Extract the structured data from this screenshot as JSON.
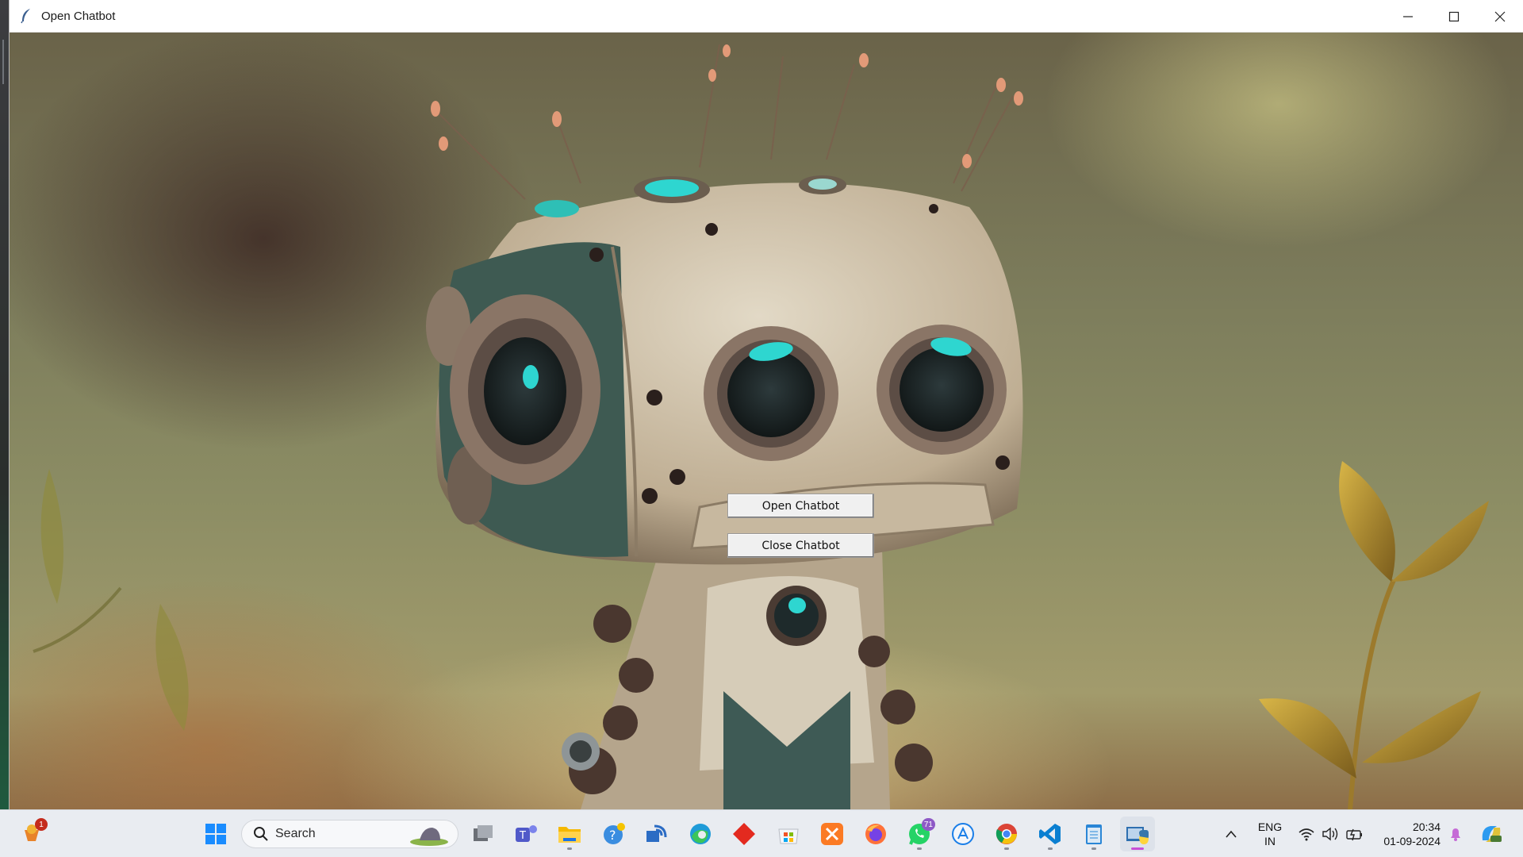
{
  "window": {
    "title": "Open Chatbot",
    "controls": [
      "minimize",
      "maximize",
      "close"
    ]
  },
  "content": {
    "background": "robot illustration",
    "open_button_label": "Open Chatbot",
    "close_button_label": "Close Chatbot"
  },
  "taskbar": {
    "search_placeholder": "Search",
    "pinned": [
      {
        "name": "weather-widget-icon",
        "badge": "1"
      },
      {
        "name": "start-icon"
      },
      {
        "name": "task-view-icon"
      },
      {
        "name": "teams-icon"
      },
      {
        "name": "file-explorer-icon"
      },
      {
        "name": "help-icon"
      },
      {
        "name": "remote-connection-icon"
      },
      {
        "name": "edge-icon"
      },
      {
        "name": "app-red-diamond-icon"
      },
      {
        "name": "microsoft-store-icon"
      },
      {
        "name": "xampp-icon"
      },
      {
        "name": "firefox-icon"
      },
      {
        "name": "whatsapp-icon",
        "badge": "71"
      },
      {
        "name": "app-store-a-icon"
      },
      {
        "name": "chrome-icon"
      },
      {
        "name": "vscode-icon"
      },
      {
        "name": "notepad-icon"
      },
      {
        "name": "python-app-icon",
        "active": true
      }
    ],
    "language": {
      "line1": "ENG",
      "line2": "IN"
    },
    "clock": {
      "time": "20:34",
      "date": "01-09-2024"
    }
  },
  "colors": {
    "accent_teal": "#2ed6d0",
    "taskbar_bg": "#e9ecf1",
    "active_indicator": "#c84fd6"
  }
}
